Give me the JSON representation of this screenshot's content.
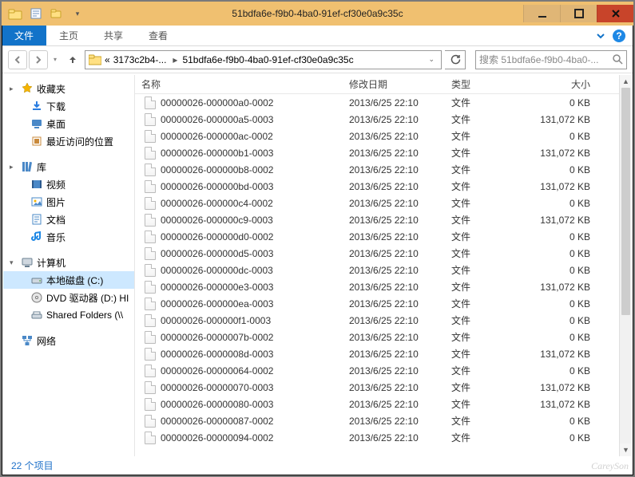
{
  "window": {
    "title": "51bdfa6e-f9b0-4ba0-91ef-cf30e0a9c35c"
  },
  "ribbon": {
    "tabs": [
      "文件",
      "主页",
      "共享",
      "查看"
    ],
    "active_index": 0
  },
  "address": {
    "part1": "3173c2b4-...",
    "part2": "51bdfa6e-f9b0-4ba0-91ef-cf30e0a9c35c",
    "prefix": "«"
  },
  "search": {
    "placeholder": "搜索 51bdfa6e-f9b0-4ba0-..."
  },
  "sidebar": {
    "groups": [
      {
        "icon": "star",
        "label": "收藏夹",
        "exp": "▸",
        "color": "#f5b400",
        "items": [
          {
            "icon": "download",
            "label": "下载",
            "color": "#2a7de1"
          },
          {
            "icon": "desktop",
            "label": "桌面",
            "color": "#4a88c7"
          },
          {
            "icon": "recent",
            "label": "最近访问的位置",
            "color": "#c9893b"
          }
        ]
      },
      {
        "icon": "library",
        "label": "库",
        "exp": "▸",
        "color": "#4a88c7",
        "items": [
          {
            "icon": "video",
            "label": "视频",
            "color": "#4a88c7"
          },
          {
            "icon": "picture",
            "label": "图片",
            "color": "#4a88c7"
          },
          {
            "icon": "document",
            "label": "文档",
            "color": "#4a88c7"
          },
          {
            "icon": "music",
            "label": "音乐",
            "color": "#1e88e5"
          }
        ]
      },
      {
        "icon": "computer",
        "label": "计算机",
        "exp": "▾",
        "color": "#6a7f91",
        "items": [
          {
            "icon": "drive",
            "label": "本地磁盘 (C:)",
            "selected": true,
            "color": "#6a7f91"
          },
          {
            "icon": "dvd",
            "label": "DVD 驱动器 (D:) HI",
            "color": "#7a7a7a"
          },
          {
            "icon": "share",
            "label": "Shared Folders (\\\\",
            "color": "#6a7f91"
          }
        ]
      },
      {
        "icon": "network",
        "label": "网络",
        "exp": "",
        "color": "#4a88c7",
        "items": []
      }
    ]
  },
  "list": {
    "columns": {
      "name": "名称",
      "date": "修改日期",
      "type": "类型",
      "size": "大小"
    },
    "rows": [
      {
        "name": "00000026-000000a0-0002",
        "date": "2013/6/25 22:10",
        "type": "文件",
        "size": "0 KB"
      },
      {
        "name": "00000026-000000a5-0003",
        "date": "2013/6/25 22:10",
        "type": "文件",
        "size": "131,072 KB"
      },
      {
        "name": "00000026-000000ac-0002",
        "date": "2013/6/25 22:10",
        "type": "文件",
        "size": "0 KB"
      },
      {
        "name": "00000026-000000b1-0003",
        "date": "2013/6/25 22:10",
        "type": "文件",
        "size": "131,072 KB"
      },
      {
        "name": "00000026-000000b8-0002",
        "date": "2013/6/25 22:10",
        "type": "文件",
        "size": "0 KB"
      },
      {
        "name": "00000026-000000bd-0003",
        "date": "2013/6/25 22:10",
        "type": "文件",
        "size": "131,072 KB"
      },
      {
        "name": "00000026-000000c4-0002",
        "date": "2013/6/25 22:10",
        "type": "文件",
        "size": "0 KB"
      },
      {
        "name": "00000026-000000c9-0003",
        "date": "2013/6/25 22:10",
        "type": "文件",
        "size": "131,072 KB"
      },
      {
        "name": "00000026-000000d0-0002",
        "date": "2013/6/25 22:10",
        "type": "文件",
        "size": "0 KB"
      },
      {
        "name": "00000026-000000d5-0003",
        "date": "2013/6/25 22:10",
        "type": "文件",
        "size": "0 KB"
      },
      {
        "name": "00000026-000000dc-0003",
        "date": "2013/6/25 22:10",
        "type": "文件",
        "size": "0 KB"
      },
      {
        "name": "00000026-000000e3-0003",
        "date": "2013/6/25 22:10",
        "type": "文件",
        "size": "131,072 KB"
      },
      {
        "name": "00000026-000000ea-0003",
        "date": "2013/6/25 22:10",
        "type": "文件",
        "size": "0 KB"
      },
      {
        "name": "00000026-000000f1-0003",
        "date": "2013/6/25 22:10",
        "type": "文件",
        "size": "0 KB"
      },
      {
        "name": "00000026-0000007b-0002",
        "date": "2013/6/25 22:10",
        "type": "文件",
        "size": "0 KB"
      },
      {
        "name": "00000026-0000008d-0003",
        "date": "2013/6/25 22:10",
        "type": "文件",
        "size": "131,072 KB"
      },
      {
        "name": "00000026-00000064-0002",
        "date": "2013/6/25 22:10",
        "type": "文件",
        "size": "0 KB"
      },
      {
        "name": "00000026-00000070-0003",
        "date": "2013/6/25 22:10",
        "type": "文件",
        "size": "131,072 KB"
      },
      {
        "name": "00000026-00000080-0003",
        "date": "2013/6/25 22:10",
        "type": "文件",
        "size": "131,072 KB"
      },
      {
        "name": "00000026-00000087-0002",
        "date": "2013/6/25 22:10",
        "type": "文件",
        "size": "0 KB"
      },
      {
        "name": "00000026-00000094-0002",
        "date": "2013/6/25 22:10",
        "type": "文件",
        "size": "0 KB"
      }
    ]
  },
  "status": {
    "text": "22 个项目"
  },
  "watermark": "CareySon"
}
